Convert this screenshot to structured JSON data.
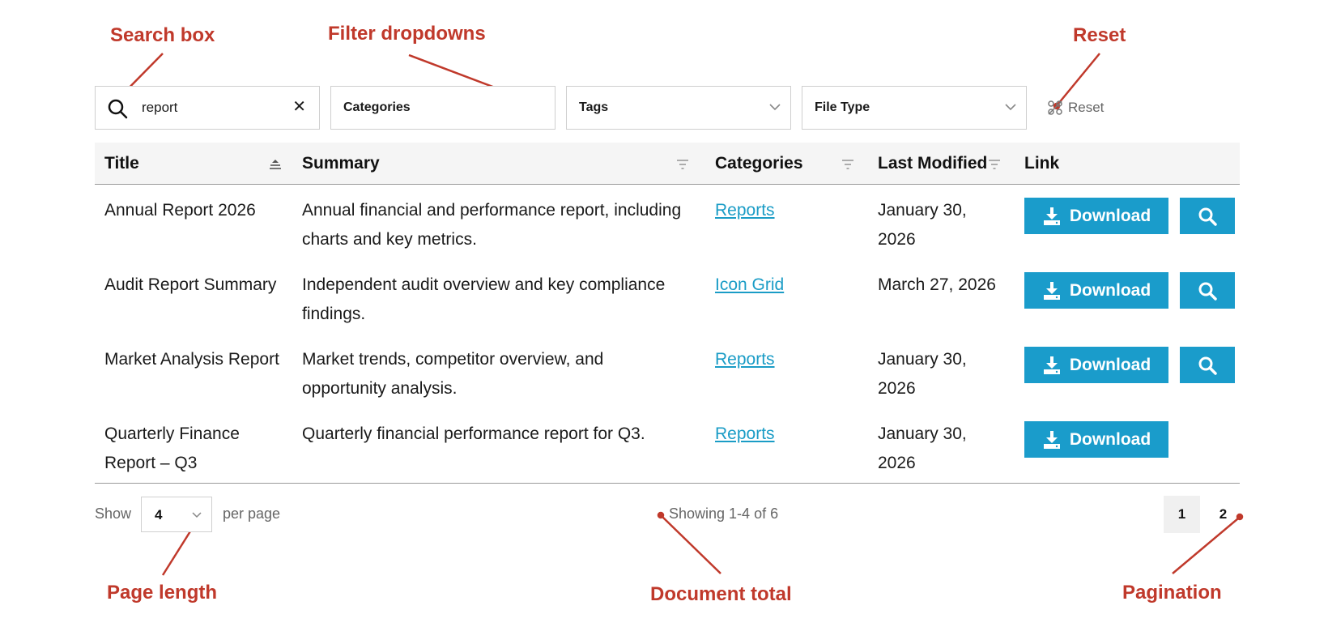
{
  "annotations": {
    "search_box": "Search box",
    "filter_dropdowns": "Filter dropdowns",
    "reset": "Reset",
    "page_length": "Page length",
    "document_total": "Document total",
    "pagination": "Pagination",
    "color": "#c0392b"
  },
  "toolbar": {
    "search_value": "report",
    "clear_glyph": "✕",
    "filters": {
      "categories": "Categories",
      "tags": "Tags",
      "file_type": "File Type"
    },
    "reset_label": "Reset"
  },
  "table": {
    "columns": {
      "title": "Title",
      "summary": "Summary",
      "categories": "Categories",
      "last_modified": "Last Modified",
      "link": "Link"
    },
    "rows": [
      {
        "title_lines": [
          "Annual Report 2026"
        ],
        "summary_lines": [
          "Annual financial and performance report, including",
          "charts and key metrics."
        ],
        "category": "Reports",
        "date_lines": [
          "January 30,",
          "2026"
        ],
        "has_preview": true
      },
      {
        "title_lines": [
          "Audit Report Summary"
        ],
        "summary_lines": [
          "Independent audit overview and key compliance",
          "findings."
        ],
        "category": "Icon Grid",
        "date_lines": [
          "March 27, 2026"
        ],
        "has_preview": true
      },
      {
        "title_lines": [
          "Market Analysis Report"
        ],
        "summary_lines": [
          "Market trends, competitor overview, and",
          "opportunity analysis."
        ],
        "category": "Reports",
        "date_lines": [
          "January 30,",
          "2026"
        ],
        "has_preview": true
      },
      {
        "title_lines": [
          "Quarterly Finance",
          "Report – Q3"
        ],
        "summary_lines": [
          "Quarterly financial performance report for Q3."
        ],
        "category": "Reports",
        "date_lines": [
          "January 30,",
          "2026"
        ],
        "has_preview": false
      }
    ],
    "download_label": "Download",
    "accent": "#1a9ccb",
    "link_color": "#1a9cc6"
  },
  "footer": {
    "show_label": "Show",
    "page_length": "4",
    "per_page_label": "per page",
    "info": "Showing 1-4 of 6",
    "pages": [
      "1",
      "2"
    ],
    "current_page": "1"
  }
}
